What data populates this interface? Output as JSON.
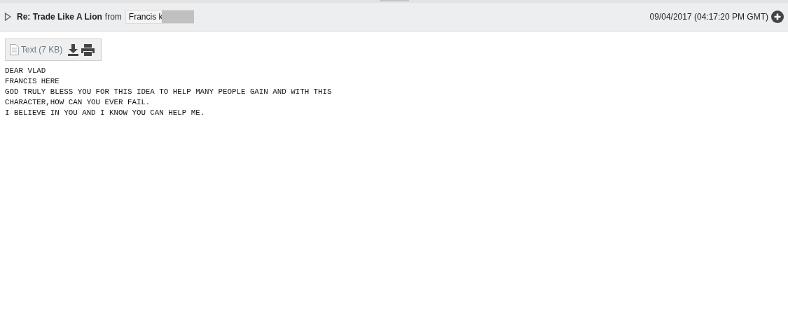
{
  "message": {
    "expanded": false,
    "subject": "Re: Trade Like A Lion",
    "from_label": "from",
    "sender": "Francis k",
    "date": "09/04/2017 (04:17:20 PM GMT)"
  },
  "attachment": {
    "label": "Text (7 KB)"
  },
  "body": [
    "DEAR VLAD",
    "FRANCIS HERE",
    "GOD TRULY BLESS YOU FOR THIS IDEA TO HELP MANY PEOPLE GAIN AND WITH THIS",
    "CHARACTER,HOW CAN YOU EVER FAIL.",
    "I BELIEVE IN YOU AND I KNOW YOU CAN HELP ME."
  ]
}
